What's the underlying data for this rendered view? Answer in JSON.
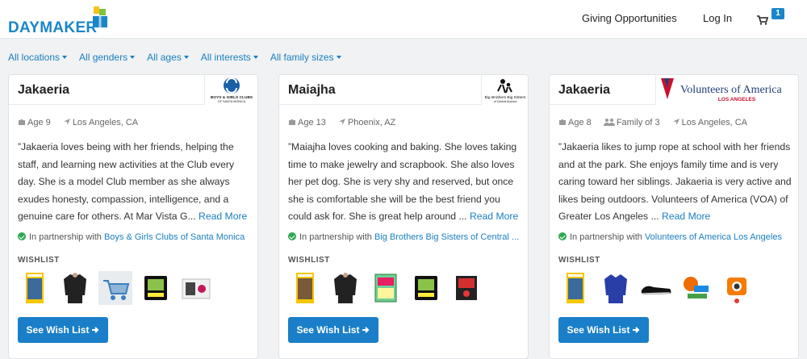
{
  "header": {
    "logo_text": "DAYMAKER",
    "nav": [
      "Giving Opportunities",
      "Log In"
    ],
    "cart_count": "1",
    "brand_color": "#1a86c8"
  },
  "filters": [
    "All locations",
    "All genders",
    "All ages",
    "All interests",
    "All family sizes"
  ],
  "cards": [
    {
      "name": "Jakaeria",
      "org_logo": "Boys & Girls Clubs of Santa Monica",
      "meta": {
        "age": "Age 9",
        "family": "",
        "location": "Los Angeles, CA"
      },
      "description": "”Jakaeria loves being with her friends, helping the staff, and learning new activities at the Club every day. She is a model Club member as she always exudes honesty, compassion, intelligence, and a genuine care for others. At Mar Vista G...",
      "read_more": "Read More",
      "partner_prefix": "In partnership with",
      "partner_name": "Boys & Girls Clubs of Santa Monica",
      "wishlist_label": "WISHLIST",
      "wishlist_items": [
        "book-icon",
        "jacket-icon",
        "cart-toy-icon",
        "tablet-icon",
        "game-icon"
      ],
      "button": "See Wish List"
    },
    {
      "name": "Maiajha",
      "org_logo": "Big Brothers Big Sisters of Central Arizona",
      "meta": {
        "age": "Age 13",
        "family": "",
        "location": "Phoenix, AZ"
      },
      "description": "”Maiajha loves cooking and baking. She loves taking time to make jewelry and scrapbook. She also loves her pet dog. She is very shy and reserved, but once she is comfortable she will be the best friend you could ask for. She is great help around ...",
      "read_more": "Read More",
      "partner_prefix": "In partnership with",
      "partner_name": "Big Brothers Big Sisters of Central ...",
      "wishlist_label": "WISHLIST",
      "wishlist_items": [
        "book-icon",
        "jacket-icon",
        "kit-icon",
        "tablet-icon",
        "game-icon"
      ],
      "button": "See Wish List"
    },
    {
      "name": "Jakaeria",
      "org_logo": "Volunteers of America Los Angeles",
      "meta": {
        "age": "Age 8",
        "family": "Family of 3",
        "location": "Los Angeles, CA"
      },
      "description": "”Jakaeria likes to jump rope at school with her friends and at the park. She enjoys family time and is very caring toward her siblings. Jakaeria is very active and likes being outdoors. Volunteers of America (VOA) of Greater Los Angeles ...",
      "read_more": "Read More",
      "partner_prefix": "In partnership with",
      "partner_name": "Volunteers of America Los Angeles",
      "wishlist_label": "WISHLIST",
      "wishlist_items": [
        "book-icon",
        "hoodie-icon",
        "shoes-icon",
        "toy-icon",
        "camera-icon"
      ],
      "button": "See Wish List"
    }
  ]
}
